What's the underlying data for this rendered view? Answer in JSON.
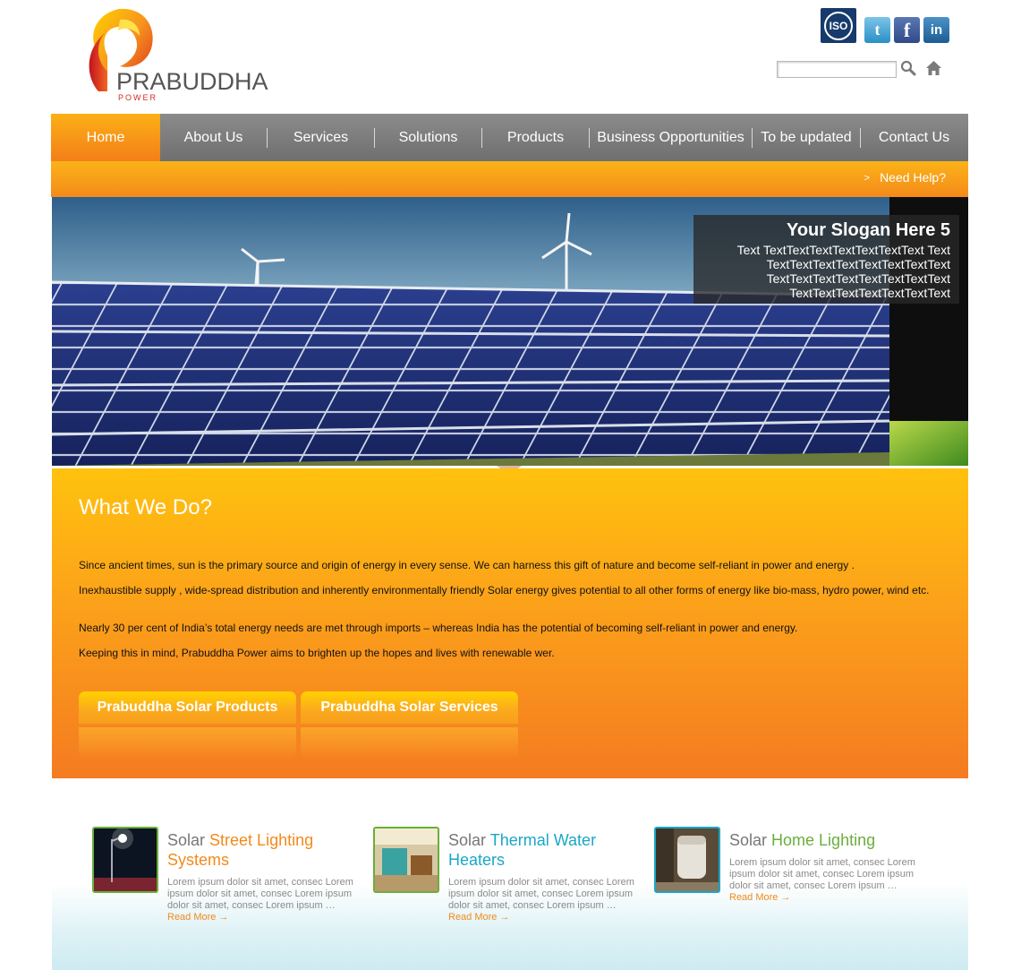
{
  "header": {
    "logo_word": "PRABUDDHA",
    "logo_sub": "POWER",
    "iso_label": "ISO",
    "social": {
      "twitter_letter": "t",
      "facebook_letter": "f",
      "linkedin_letter": "in"
    },
    "search": {
      "placeholder": "",
      "value": ""
    }
  },
  "nav": {
    "items": [
      {
        "label": "Home",
        "active": true
      },
      {
        "label": "About Us"
      },
      {
        "label": "Services"
      },
      {
        "label": "Solutions"
      },
      {
        "label": "Products"
      },
      {
        "label": "Business Opportunities"
      },
      {
        "label": "To be updated"
      },
      {
        "label": "Contact Us"
      }
    ],
    "help_arrow": ">",
    "help_label": "Need Help?"
  },
  "hero": {
    "slogan_title": "Your Slogan Here 5",
    "slogan_text": "Text TextTextTextTextTextTextText Text TextTextTextTextTextTextTextText TextTextTextTextTextTextTextText TextTextTextTextTextTextText"
  },
  "what_we_do": {
    "title": "What We Do?",
    "paragraphs": [
      "Since ancient times, sun is the primary source and origin of energy in every sense. We can harness this gift of nature and become self-reliant in power and energy .",
      "Inexhaustible supply , wide-spread distribution and inherently environmentally friendly Solar energy gives potential to all other forms of energy like bio-mass, hydro power, wind etc.",
      "Nearly 30 per cent of India’s total energy needs are met through imports – whereas India has the potential of becoming self-reliant in power and energy.",
      "Keeping this in mind, Prabuddha Power aims to brighten up the hopes and lives with renewable wer."
    ],
    "buttons": [
      "Prabuddha Solar Products",
      "Prabuddha Solar Services"
    ]
  },
  "features": [
    {
      "prefix": "Solar ",
      "highlight": "Street Lighting Systems",
      "color": "#f28a1b",
      "text": "Lorem ipsum dolor sit amet, consec Lorem ipsum dolor sit amet, consec Lorem ipsum dolor sit amet, consec Lorem ipsum …",
      "more": "Read More →"
    },
    {
      "prefix": "Solar ",
      "highlight": "Thermal Water Heaters",
      "color": "#1aa7c7",
      "text": "Lorem ipsum dolor sit amet, consec Lorem ipsum dolor sit amet, consec Lorem ipsum dolor sit amet, consec Lorem ipsum …",
      "more": "Read More →"
    },
    {
      "prefix": "Solar ",
      "highlight": "Home Lighting",
      "color": "#6aae3c",
      "text": "Lorem ipsum dolor sit amet, consec Lorem ipsum dolor sit amet, consec Lorem ipsum dolor sit amet, consec Lorem ipsum …",
      "more": "Read More →"
    }
  ],
  "colors": {
    "orange": "#f47e19",
    "yellow": "#fbb016",
    "nav_gray": "#7d7d7d",
    "link_orange": "#f28a1b"
  },
  "icons": [
    "logo-swirl",
    "iso-badge",
    "twitter-icon",
    "facebook-icon",
    "linkedin-icon",
    "search-icon",
    "home-icon",
    "chevron-right-icon"
  ]
}
